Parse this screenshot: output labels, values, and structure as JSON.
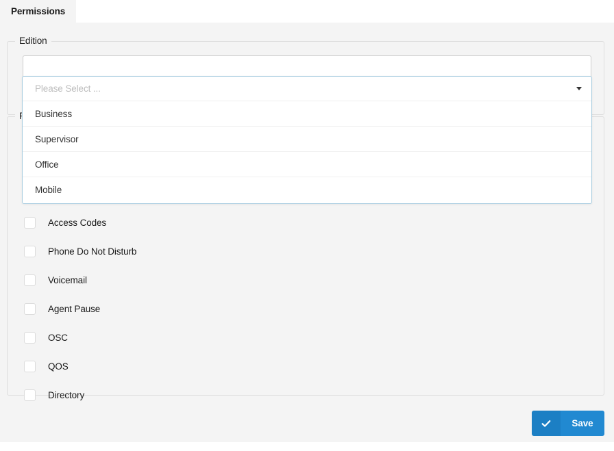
{
  "tabs": [
    {
      "label": "Permissions",
      "active": true
    }
  ],
  "fieldsets": {
    "edition": {
      "legend": "Edition"
    },
    "permissions": {
      "legend": "Pe"
    }
  },
  "edition_select": {
    "placeholder": "Please Select ...",
    "caret_icon": "chevron-down-icon",
    "expanded": true,
    "options": [
      {
        "label": "Business"
      },
      {
        "label": "Supervisor"
      },
      {
        "label": "Office"
      },
      {
        "label": "Mobile"
      }
    ]
  },
  "permissions": {
    "items": [
      {
        "label": "Access Codes",
        "checked": false
      },
      {
        "label": "Phone Do Not Disturb",
        "checked": false
      },
      {
        "label": "Voicemail",
        "checked": false
      },
      {
        "label": "Agent Pause",
        "checked": false
      },
      {
        "label": "OSC",
        "checked": false
      },
      {
        "label": "QOS",
        "checked": false
      },
      {
        "label": "Directory",
        "checked": false
      }
    ]
  },
  "footer": {
    "save_label": "Save",
    "save_icon": "check-icon"
  },
  "colors": {
    "accent": "#2189d1",
    "accent_dark": "#1c7fc4",
    "panel_bg": "#f4f4f4",
    "dropdown_border": "#a9cde0",
    "fieldset_border": "#dddddd"
  }
}
